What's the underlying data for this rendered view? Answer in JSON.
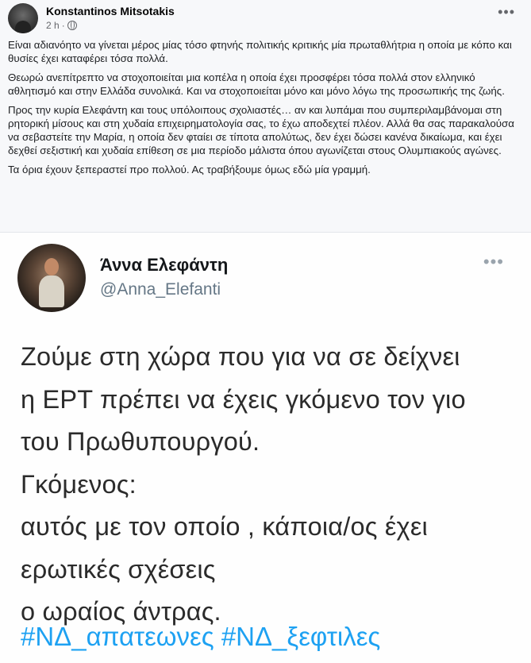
{
  "post": {
    "author": "Konstantinos Mitsotakis",
    "time": "2 h",
    "separator": "·",
    "more": "•••",
    "paragraphs": [
      "Είναι αδιανόητο να γίνεται μέρος μίας τόσο φτηνής πολιτικής κριτικής μία πρωταθλήτρια η οποία με κόπο και θυσίες έχει καταφέρει τόσα πολλά.",
      "Θεωρώ ανεπίτρεπτο να στοχοποιείται μια κοπέλα η οποία έχει προσφέρει τόσα πολλά στον ελληνικό αθλητισμό και στην Ελλάδα συνολικά. Και να στοχοποιείται μόνο και μόνο λόγω της προσωπικής της ζωής.",
      "Προς την κυρία Ελεφάντη και τους υπόλοιπους σχολιαστές… αν και λυπάμαι που συμπεριλαμβάνομαι στη ρητορική μίσους και στη χυδαία επιχειρηματολογία σας, το έχω αποδεχτεί πλέον. Αλλά θα σας παρακαλούσα να σεβαστείτε την Μαρία, η οποία δεν φταίει σε τίποτα απολύτως, δεν έχει δώσει κανένα δικαίωμα, και έχει δεχθεί σεξιστική και χυδαία επίθεση σε μια περίοδο μάλιστα όπου αγωνίζεται στους Ολυμπιακούς αγώνες.",
      "Τα όρια έχουν ξεπεραστεί προ πολλού. Ας τραβήξουμε όμως εδώ μία γραμμή."
    ]
  },
  "tweet": {
    "name": "Άννα Ελεφάντη",
    "handle": "@Anna_Elefanti",
    "more": "•••",
    "lines": [
      "Ζούμε στη χώρα που για να σε δείχνει",
      "η ΕΡΤ πρέπει να έχεις γκόμενο τον γιο",
      "του Πρωθυπουργού.",
      "Γκόμενος:",
      "αυτός με τον οποίο , κάποια/ος έχει",
      "ερωτικές σχέσεις",
      "ο ωραίος άντρας."
    ],
    "hashtags": "#ΝΔ_απατεωνες #ΝΔ_ξεφτιλες"
  },
  "colors": {
    "link_blue": "#1da1f2",
    "meta_gray": "#65676b",
    "background": "#f7f8fa"
  }
}
